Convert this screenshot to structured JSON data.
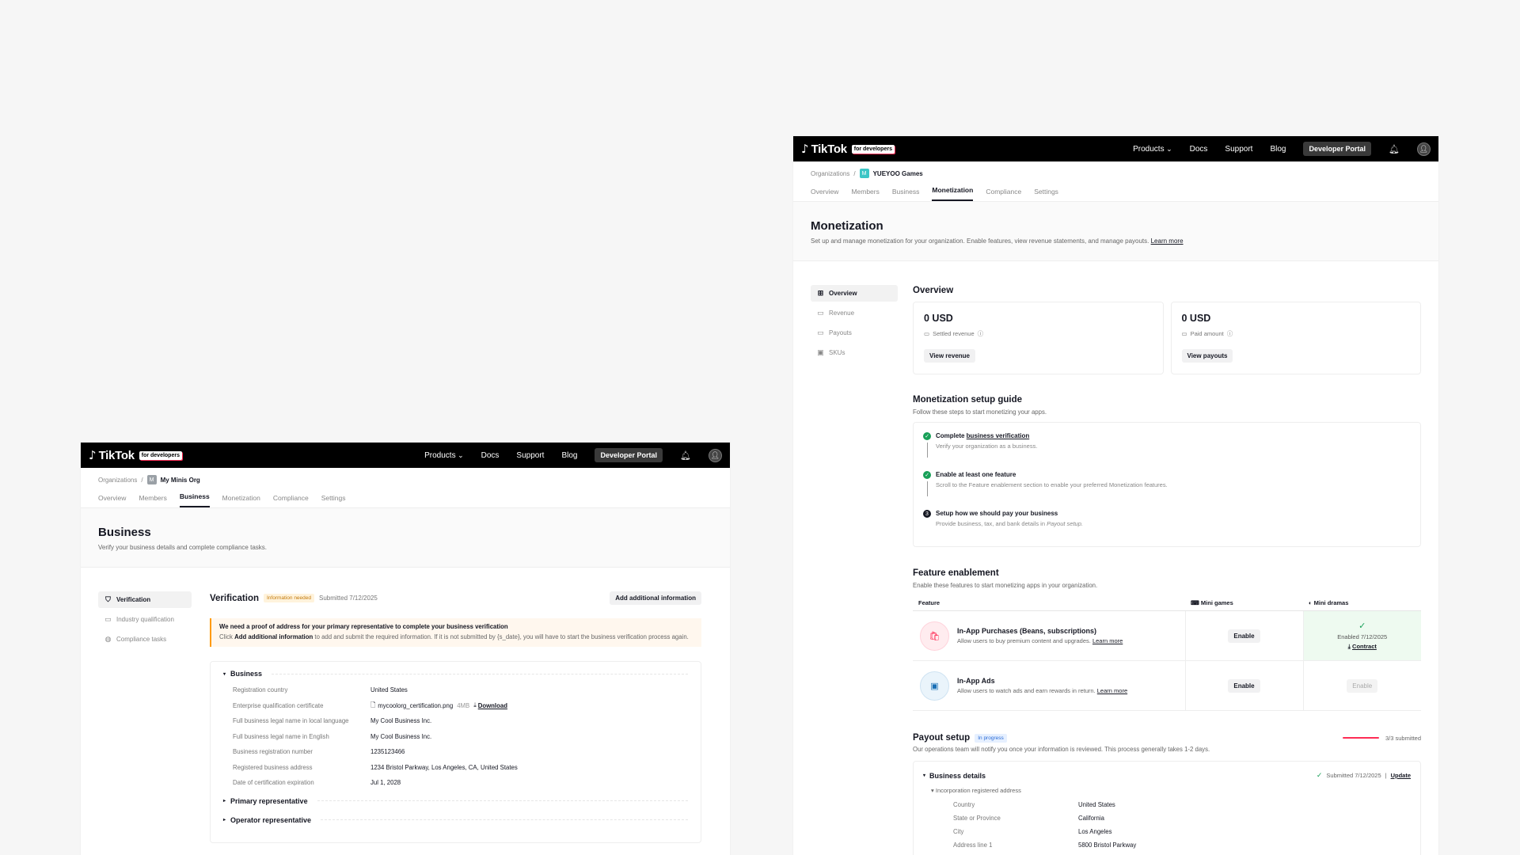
{
  "nav": {
    "logo_word": "TikTok",
    "for_dev": "for developers",
    "products": "Products",
    "docs": "Docs",
    "support": "Support",
    "blog": "Blog",
    "portal": "Developer Portal"
  },
  "w1": {
    "crumb_root": "Organizations",
    "org_initial": "M",
    "org_name": "My Minis Org",
    "tabs": [
      "Overview",
      "Members",
      "Business",
      "Monetization",
      "Compliance",
      "Settings"
    ],
    "title": "Business",
    "subtitle": "Verify your business details and complete compliance tasks.",
    "side": [
      "Verification",
      "Industry qualification",
      "Compliance tasks"
    ],
    "verif_title": "Verification",
    "verif_tag": "Information needed",
    "submitted": "Submitted 7/12/2025",
    "add_btn": "Add additional information",
    "alert_title": "We need a proof of address for your primary representative to complete your business verification",
    "alert_pre": "Click ",
    "alert_bold": "Add additional information",
    "alert_post": " to add and submit the required information. If it is not submitted by {s_date}, you will have to start the business verification process again.",
    "sec_business": "Business",
    "rows": [
      {
        "k": "Registration country",
        "v": "United States"
      },
      {
        "k": "Enterprise qualification certificate",
        "v": "mycoolorg_certification.png"
      },
      {
        "k": "Full business legal name in local language",
        "v": "My Cool Business Inc."
      },
      {
        "k": "Full business legal name in English",
        "v": "My Cool Business Inc."
      },
      {
        "k": "Business registration number",
        "v": "1235123466"
      },
      {
        "k": "Registered business address",
        "v": "1234 Bristol Parkway, Los Angeles, CA, United States"
      },
      {
        "k": "Date of certification expiration",
        "v": "Jul 1, 2028"
      }
    ],
    "file_size": "4MB",
    "download": "Download",
    "sec_primary": "Primary representative",
    "sec_operator": "Operator representative"
  },
  "w2": {
    "crumb_root": "Organizations",
    "org_initial": "M",
    "org_name": "YUEYOO Games",
    "tabs": [
      "Overview",
      "Members",
      "Business",
      "Monetization",
      "Compliance",
      "Settings"
    ],
    "title": "Monetization",
    "subtitle": "Set up and manage monetization for your organization. Enable features, view revenue statements, and manage payouts.",
    "learn_more": "Learn more",
    "side": [
      "Overview",
      "Revenue",
      "Payouts",
      "SKUs"
    ],
    "ov_title": "Overview",
    "cards": [
      {
        "amount": "0 USD",
        "label": "Settled revenue",
        "btn": "View revenue"
      },
      {
        "amount": "0 USD",
        "label": "Paid amount",
        "btn": "View payouts"
      }
    ],
    "guide_title": "Monetization setup guide",
    "guide_sub": "Follow these steps to start monetizing your apps.",
    "steps": [
      {
        "pre": "Complete ",
        "link": "business verification",
        "desc": "Verify your organization as a business."
      },
      {
        "pre": "Enable at least one feature",
        "link": "",
        "desc": "Scroll to the Feature enablement section to enable your preferred Monetization features."
      },
      {
        "pre": "Setup how we should pay your business",
        "link": "",
        "desc": "Provide business, tax, and bank details in ",
        "desc_i": "Payout setup."
      }
    ],
    "step3_num": "3",
    "fe_title": "Feature enablement",
    "fe_sub": "Enable these features to start monetizing apps in your organization.",
    "fe_cols": [
      "Feature",
      "Mini games",
      "Mini dramas"
    ],
    "features": [
      {
        "name": "In-App Purchases (Beans, subscriptions)",
        "desc": "Allow users to buy premium content and upgrades.",
        "link": "Learn more",
        "games": "Enable",
        "dramas_status": "Enabled 7/12/2025",
        "dramas_link": "Contract"
      },
      {
        "name": "In-App Ads",
        "desc": "Allow users to watch ads and earn rewards in return.",
        "link": "Learn more",
        "games": "Enable",
        "dramas_btn": "Enable"
      }
    ],
    "payout_title": "Payout setup",
    "payout_tag": "In progress",
    "payout_progress": "3/3 submitted",
    "payout_progress_frac": 1.0,
    "payout_sub": "Our operations team will notify you once your information is reviewed. This process generally takes 1-2 days.",
    "bd_title": "Business details",
    "bd_submitted": "Submitted 7/12/2025",
    "bd_update": "Update",
    "bd_sub": "Incorporation registered address",
    "addr": [
      {
        "k": "Country",
        "v": "United States"
      },
      {
        "k": "State or Province",
        "v": "California"
      },
      {
        "k": "City",
        "v": "Los Angeles"
      },
      {
        "k": "Address line 1",
        "v": "5800 Bristol Parkway"
      }
    ]
  }
}
